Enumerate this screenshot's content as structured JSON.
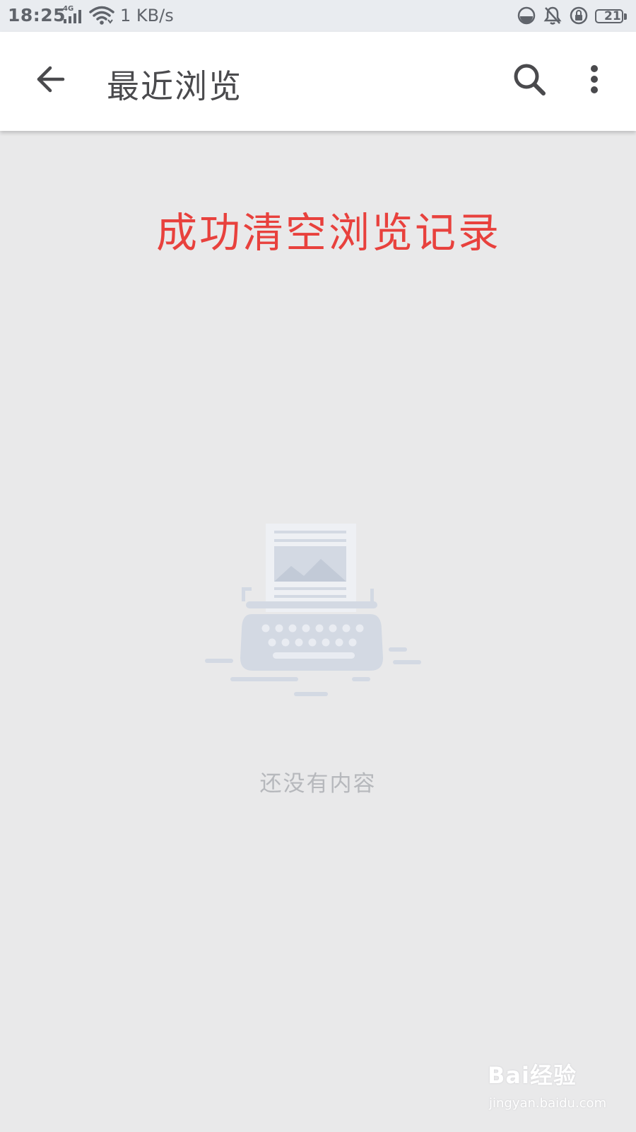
{
  "status_bar": {
    "time": "18:25",
    "network_type": "4G",
    "speed": "1 KB/s",
    "battery_level": "21"
  },
  "app_bar": {
    "title": "最近浏览",
    "back_icon": "arrow-left-icon",
    "search_icon": "search-icon",
    "more_icon": "more-vert-icon"
  },
  "annotation": {
    "text": "成功清空浏览记录",
    "color": "#e8413d"
  },
  "empty_state": {
    "illustration_icon": "typewriter-icon",
    "message": "还没有内容"
  },
  "watermark": {
    "logo": "Bai经验",
    "url": "jingyan.baidu.com"
  },
  "colors": {
    "background": "#e9e9ea",
    "app_bar": "#ffffff",
    "illustration": "#d3d9e3"
  }
}
